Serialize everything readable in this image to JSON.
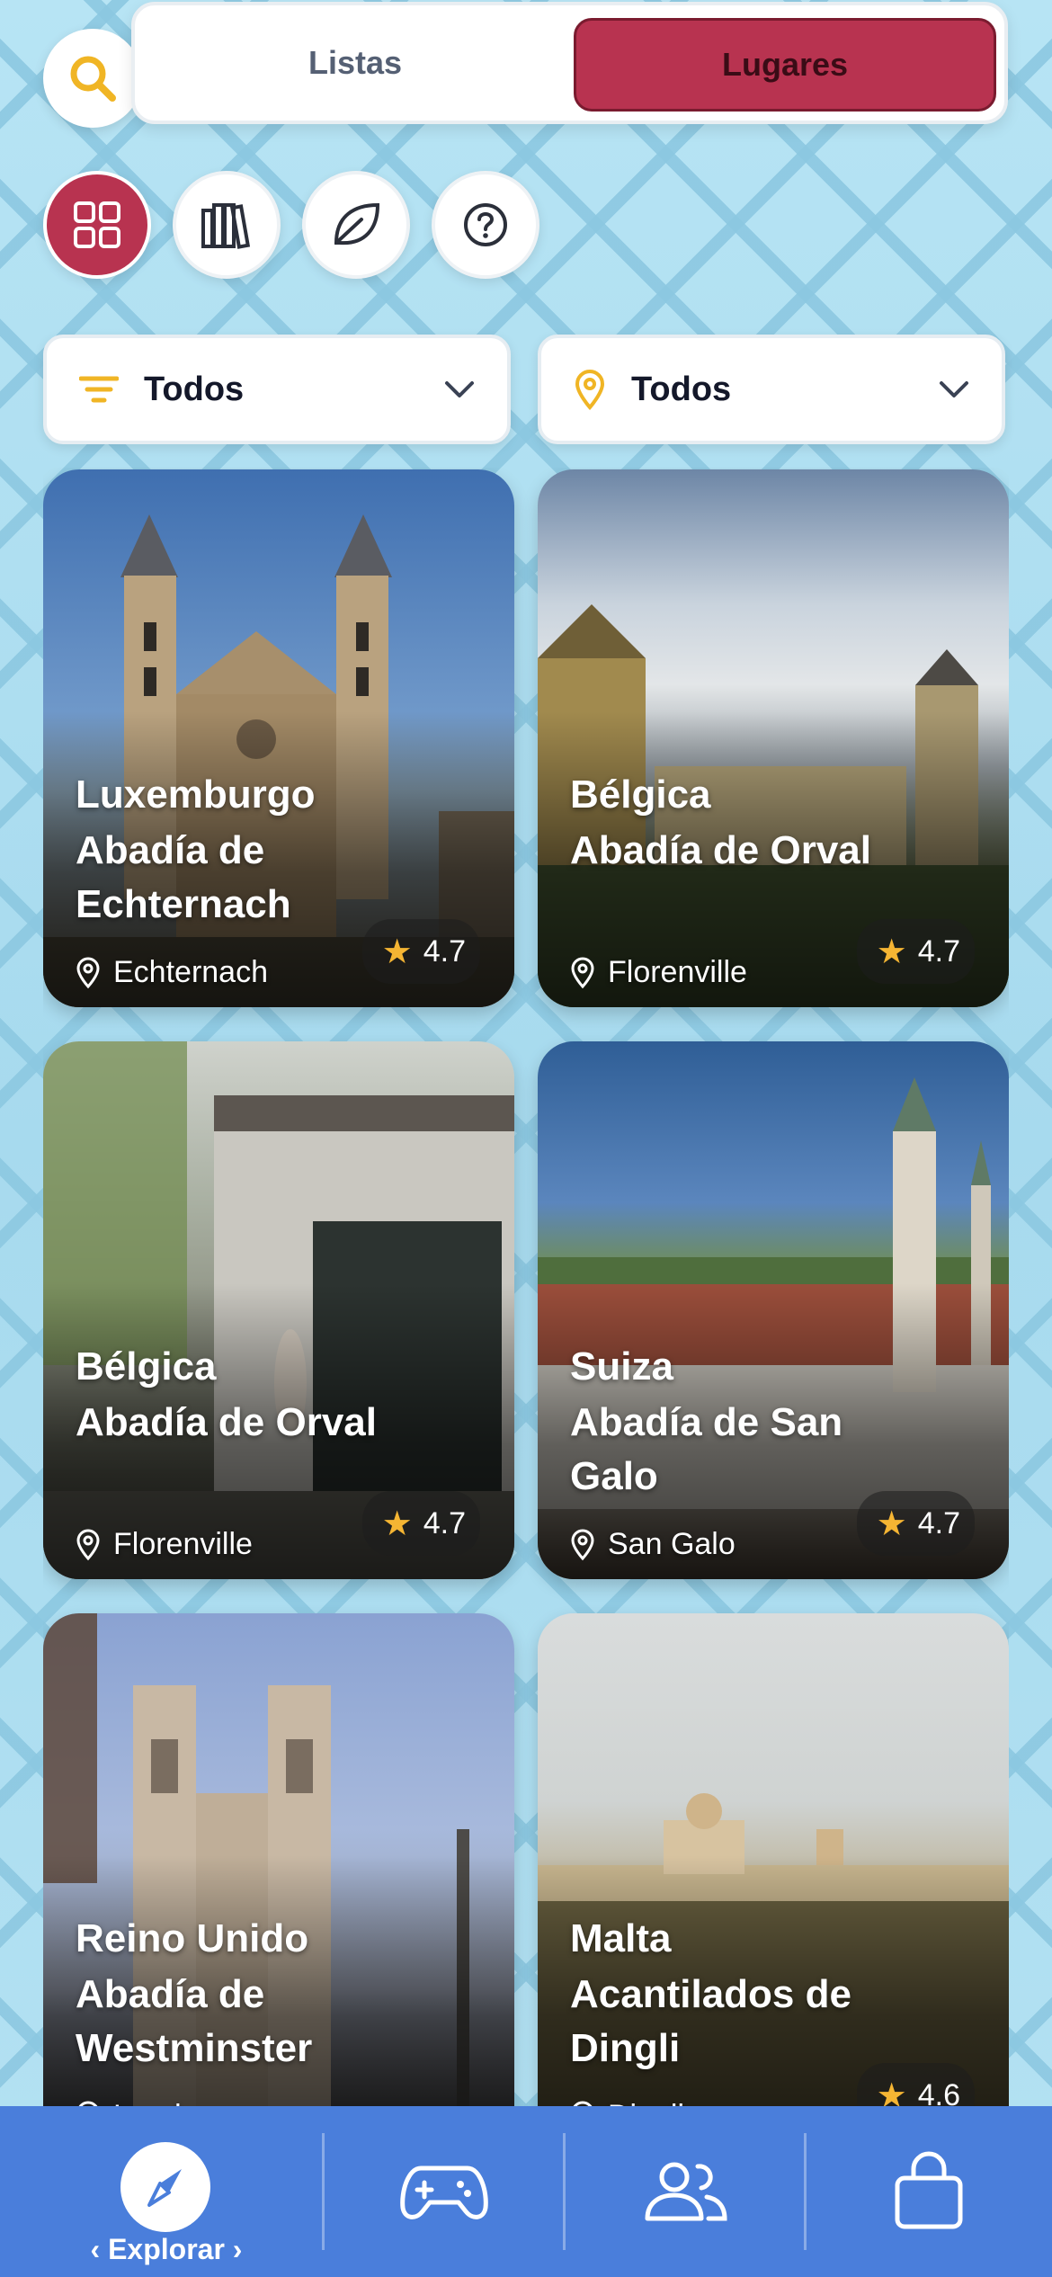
{
  "header": {
    "search_icon": "search-icon",
    "tabs": {
      "left": "Listas",
      "right": "Lugares"
    }
  },
  "categories": [
    {
      "icon": "grid-icon",
      "active": true
    },
    {
      "icon": "books-icon",
      "active": false
    },
    {
      "icon": "leaf-icon",
      "active": false
    },
    {
      "icon": "help-icon",
      "active": false
    }
  ],
  "filters": {
    "type_label": "Todos",
    "location_label": "Todos"
  },
  "places": [
    {
      "country": "Luxemburgo",
      "name": "Abadía de Echternach",
      "location": "Echternach",
      "rating": "4.7"
    },
    {
      "country": "Bélgica",
      "name": "Abadía de Orval",
      "location": "Florenville",
      "rating": "4.7"
    },
    {
      "country": "Bélgica",
      "name": "Abadía de Orval",
      "location": "Florenville",
      "rating": "4.7"
    },
    {
      "country": "Suiza",
      "name": "Abadía de San Galo",
      "location": "San Galo",
      "rating": "4.7"
    },
    {
      "country": "Reino Unido",
      "name": "Abadía de Westminster",
      "location": "Londres",
      "rating": ""
    },
    {
      "country": "Malta",
      "name": "Acantilados de Dingli",
      "location": "Dingli",
      "rating": "4.6"
    }
  ],
  "bottom_nav": {
    "explore_label": "Explorar",
    "items": [
      "compass-icon",
      "gamepad-icon",
      "users-icon",
      "bag-icon"
    ]
  },
  "colors": {
    "accent": "#b83350",
    "nav": "#4a7edb",
    "star": "#f5b533"
  }
}
